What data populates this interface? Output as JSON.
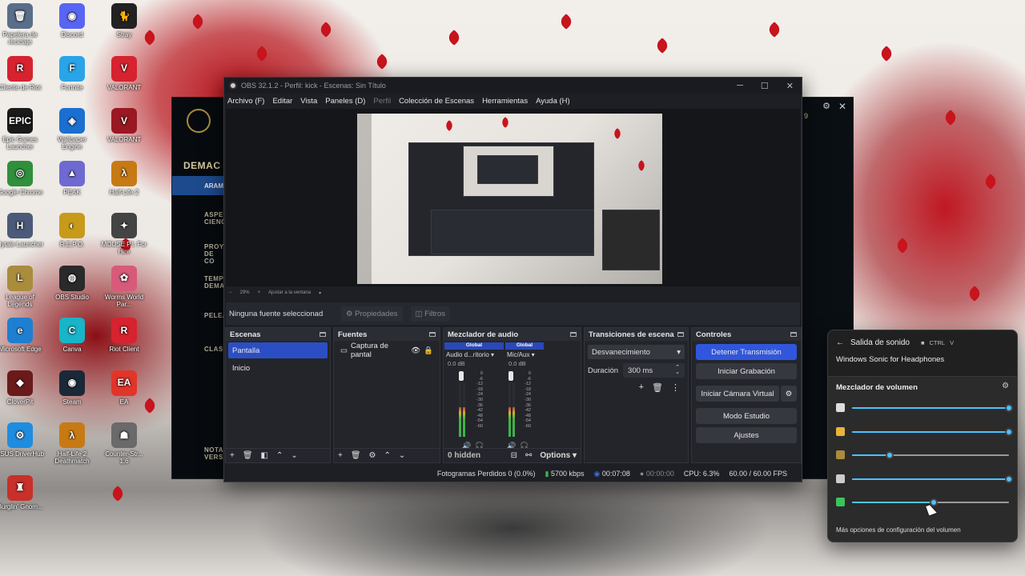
{
  "desktop_icons": [
    {
      "label": "Papelera de reciclaje",
      "glyph": "🗑",
      "color": "#5a6e8a"
    },
    {
      "label": "Discord",
      "glyph": "◉",
      "color": "#5865f2"
    },
    {
      "label": "Stray",
      "glyph": "🐈",
      "color": "#222222"
    },
    {
      "label": "Cliente de Riot",
      "glyph": "R",
      "color": "#d6232f"
    },
    {
      "label": "Fortnite",
      "glyph": "F",
      "color": "#2aa4e8"
    },
    {
      "label": "VALORANT",
      "glyph": "V",
      "color": "#d6232f"
    },
    {
      "label": "Epic Games Launcher",
      "glyph": "EPIC",
      "color": "#1a1a1a"
    },
    {
      "label": "Wallpaper Engine",
      "glyph": "◈",
      "color": "#1b6fd1"
    },
    {
      "label": "VALORANT",
      "glyph": "V",
      "color": "#9a1822"
    },
    {
      "label": "Google Chrome",
      "glyph": "◎",
      "color": "#2f8f3a"
    },
    {
      "label": "PEAK",
      "glyph": "▲",
      "color": "#6f6ad1"
    },
    {
      "label": "Half-Life 2",
      "glyph": "λ",
      "color": "#c77a14"
    },
    {
      "label": "Hytale Launcher",
      "glyph": "H",
      "color": "#4a5a78"
    },
    {
      "label": "R.E.P.O.",
      "glyph": "◐",
      "color": "#c79a1a"
    },
    {
      "label": "MOUSE P.I. For Hire",
      "glyph": "✦",
      "color": "#444444"
    },
    {
      "label": "League of Legends",
      "glyph": "L",
      "color": "#a98c3c"
    },
    {
      "label": "OBS Studio",
      "glyph": "◍",
      "color": "#2a2a2a"
    },
    {
      "label": "Worms World Par...",
      "glyph": "✿",
      "color": "#d85a7a"
    },
    {
      "label": "Microsoft Edge",
      "glyph": "e",
      "color": "#1e7fd1"
    },
    {
      "label": "Canva",
      "glyph": "C",
      "color": "#18b4c8"
    },
    {
      "label": "Riot Client",
      "glyph": "R",
      "color": "#d6232f"
    },
    {
      "label": "CloverPit",
      "glyph": "◆",
      "color": "#6a1a1a"
    },
    {
      "label": "Steam",
      "glyph": "◉",
      "color": "#1b2838"
    },
    {
      "label": "EA",
      "glyph": "EA",
      "color": "#e2352a"
    },
    {
      "label": "ASUS DriverHub",
      "glyph": "⚙",
      "color": "#1e8de0"
    },
    {
      "label": "Half-Life 2 Deathmatch",
      "glyph": "λ",
      "color": "#c77a14"
    },
    {
      "label": "Counter-Str... 1.6",
      "glyph": "☗",
      "color": "#6a6a6a"
    },
    {
      "label": "Burglin' Gnom...",
      "glyph": "♜",
      "color": "#c8302a"
    }
  ],
  "lol": {
    "items": [
      "DEMAC",
      "ARAM",
      "ASPE CIENC",
      "PROY DE CO",
      "TEMP DEMA",
      "PELEA",
      "CLAS",
      "NOTA VERS"
    ],
    "num": "9"
  },
  "obs": {
    "title": "OBS 32.1.2 - Perfil: kick - Escenas: Sin Título",
    "menu": [
      "Archivo (F)",
      "Editar",
      "Vista",
      "Paneles (D)",
      "Perfil",
      "Colección de Escenas",
      "Herramientas",
      "Ayuda (H)"
    ],
    "zoom": "29%",
    "fit": "Ajustar a la ventana",
    "no_source": "Ninguna fuente seleccionad",
    "properties": "Propiedades",
    "filters": "Filtros",
    "scenes": {
      "title": "Escenas",
      "items": [
        "Pantalla",
        "Inicio"
      ]
    },
    "sources": {
      "title": "Fuentes",
      "items": [
        "Captura de pantal"
      ]
    },
    "mixer": {
      "title": "Mezclador de audio",
      "channels": [
        {
          "global": "Global",
          "name": "Audio d...ritorio",
          "db": "0.0 dB",
          "level": 0.55
        },
        {
          "global": "Global",
          "name": "Mic/Aux",
          "db": "0.0 dB",
          "level": 0.55
        }
      ],
      "ticks": [
        "0",
        "-6",
        "-12",
        "-18",
        "-24",
        "-30",
        "-36",
        "-42",
        "-48",
        "-54",
        "-60"
      ],
      "hidden": "0 hidden",
      "options": "Options"
    },
    "transitions": {
      "title": "Transiciones de escena",
      "selected": "Desvanecimiento",
      "duration_label": "Duración",
      "duration": "300 ms"
    },
    "controls": {
      "title": "Controles",
      "stream": "Detener Transmisión",
      "record": "Iniciar Grabación",
      "vcam": "Iniciar Cámara Virtual",
      "studio": "Modo Estudio",
      "settings": "Ajustes"
    },
    "status": {
      "dropped": "Fotogramas Perdidos 0 (0.0%)",
      "bitrate": "5700 kbps",
      "stream_time": "00:07:08",
      "rec_time": "00:00:00",
      "cpu": "CPU: 6.3%",
      "fps": "60.00 / 60.00 FPS"
    }
  },
  "flyout": {
    "title": "Salida de sonido",
    "kbd_ctrl": "CTRL",
    "kbd_v": "V",
    "device": "Windows Sonic for Headphones",
    "mixer_title": "Mezclador de volumen",
    "more": "Más opciones de configuración del volumen",
    "apps": [
      {
        "name": "system-icon",
        "color": "#dddddd",
        "level": 1.0
      },
      {
        "name": "chrome-icon",
        "color": "#e8b43a",
        "level": 1.0
      },
      {
        "name": "league-icon",
        "color": "#a98c3c",
        "level": 0.24
      },
      {
        "name": "obs-icon",
        "color": "#cccccc",
        "level": 1.0
      },
      {
        "name": "app-icon",
        "color": "#3bc45b",
        "level": 0.52
      }
    ]
  }
}
